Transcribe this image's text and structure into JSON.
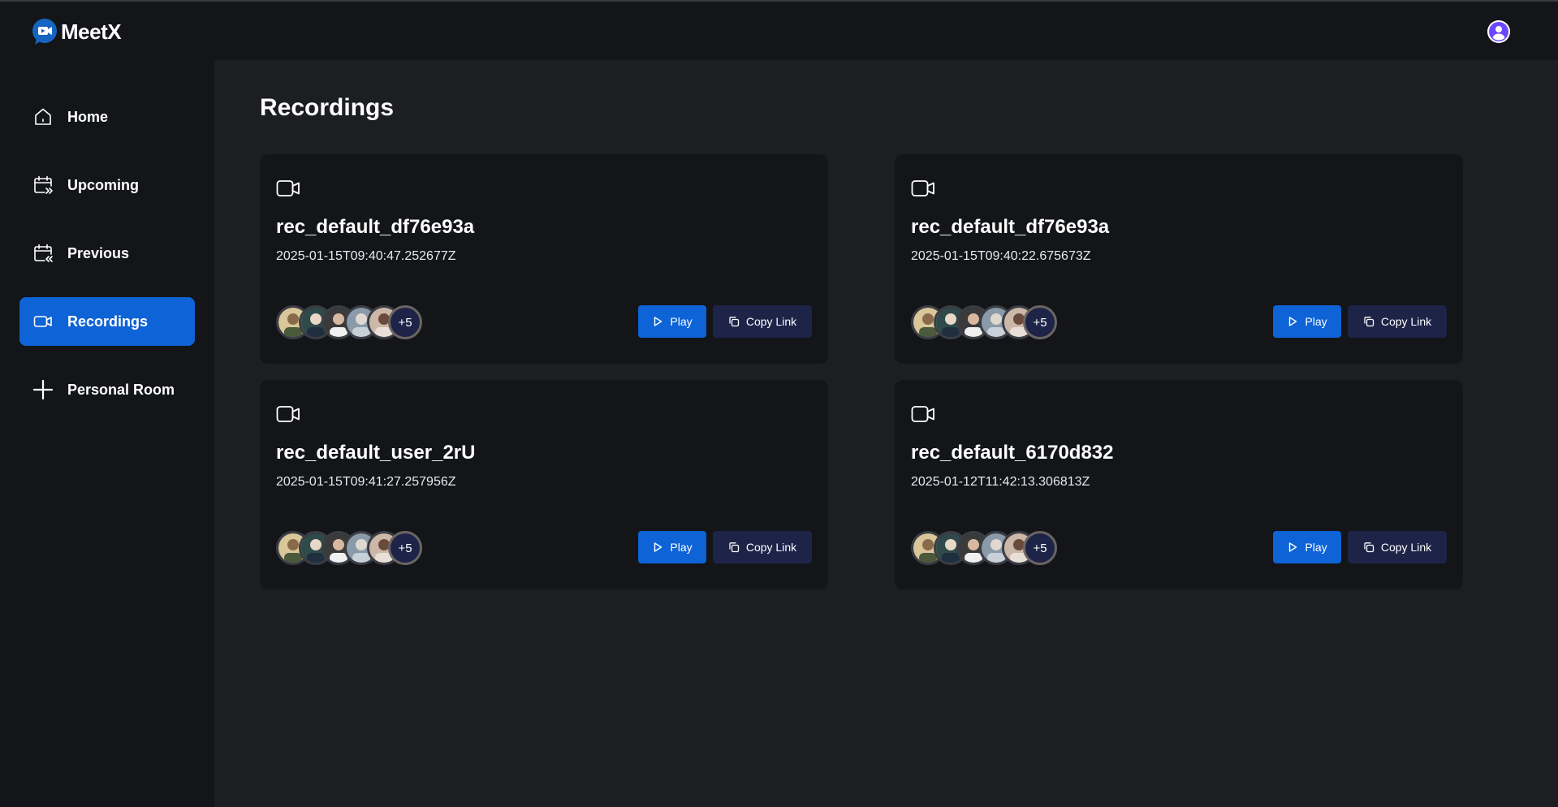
{
  "app": {
    "name": "MeetX"
  },
  "header": {
    "user_icon": "user-avatar-icon"
  },
  "sidebar": {
    "items": [
      {
        "label": "Home",
        "icon": "home-icon",
        "active": false
      },
      {
        "label": "Upcoming",
        "icon": "calendar-upcoming-icon",
        "active": false
      },
      {
        "label": "Previous",
        "icon": "calendar-previous-icon",
        "active": false
      },
      {
        "label": "Recordings",
        "icon": "video-icon",
        "active": true
      },
      {
        "label": "Personal Room",
        "icon": "plus-icon",
        "active": false
      }
    ]
  },
  "main": {
    "title": "Recordings",
    "cards": [
      {
        "title": "rec_default_df76e93a",
        "date": "2025-01-15T09:40:47.252677Z",
        "attendees_more": "+5",
        "play_label": "Play",
        "copy_label": "Copy Link"
      },
      {
        "title": "rec_default_df76e93a",
        "date": "2025-01-15T09:40:22.675673Z",
        "attendees_more": "+5",
        "play_label": "Play",
        "copy_label": "Copy Link"
      },
      {
        "title": "rec_default_user_2rU",
        "date": "2025-01-15T09:41:27.257956Z",
        "attendees_more": "+5",
        "play_label": "Play",
        "copy_label": "Copy Link"
      },
      {
        "title": "rec_default_6170d832",
        "date": "2025-01-12T11:42:13.306813Z",
        "attendees_more": "+5",
        "play_label": "Play",
        "copy_label": "Copy Link"
      }
    ]
  },
  "colors": {
    "accent": "#0e63d6",
    "secondary_button": "#1e2348",
    "sidebar_bg": "#131519",
    "main_bg": "#1c1e22",
    "card_bg": "#131519"
  }
}
